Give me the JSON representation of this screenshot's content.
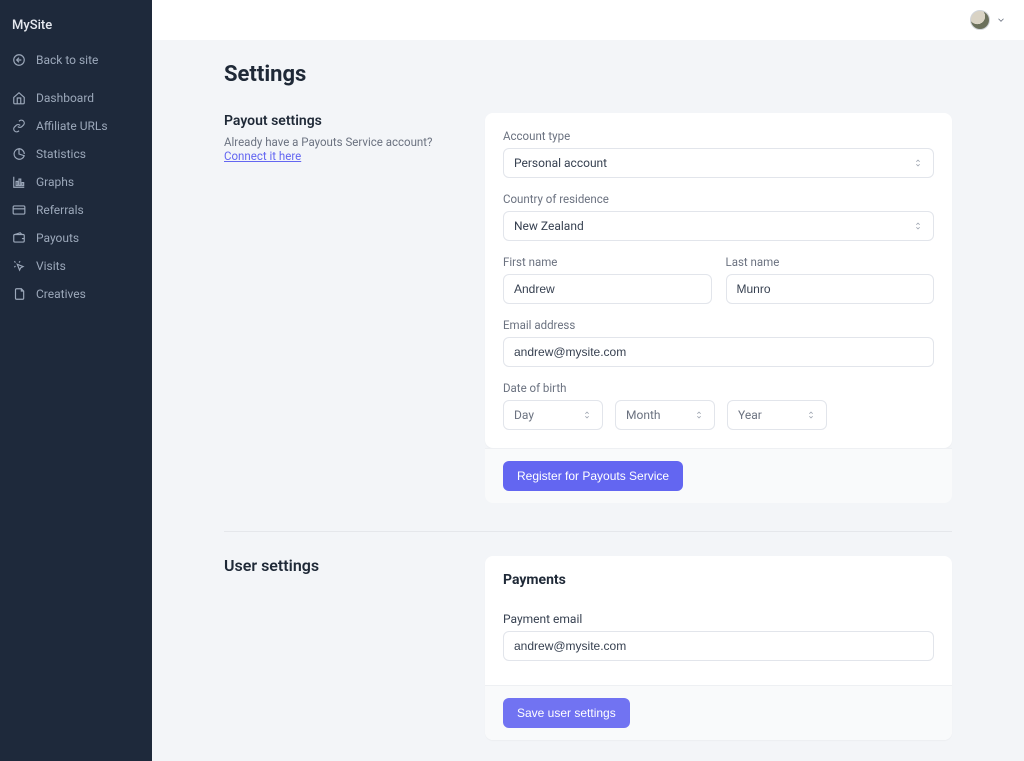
{
  "site_name": "MySite",
  "back_to_site": "Back to site",
  "nav": {
    "dashboard": "Dashboard",
    "affiliate_urls": "Affiliate URLs",
    "statistics": "Statistics",
    "graphs": "Graphs",
    "referrals": "Referrals",
    "payouts": "Payouts",
    "visits": "Visits",
    "creatives": "Creatives"
  },
  "page_title": "Settings",
  "payout": {
    "heading": "Payout settings",
    "already_text": "Already have a Payouts Service account? ",
    "connect_link": "Connect it here",
    "account_type_label": "Account type",
    "account_type_value": "Personal account",
    "country_label": "Country of residence",
    "country_value": "New Zealand",
    "first_name_label": "First name",
    "first_name_value": "Andrew",
    "last_name_label": "Last name",
    "last_name_value": "Munro",
    "email_label": "Email address",
    "email_value": "andrew@mysite.com",
    "dob_label": "Date of birth",
    "dob_day": "Day",
    "dob_month": "Month",
    "dob_year": "Year",
    "register_button": "Register for Payouts Service"
  },
  "user": {
    "heading": "User settings",
    "payments_title": "Payments",
    "payment_email_label": "Payment email",
    "payment_email_value": "andrew@mysite.com",
    "save_button": "Save user settings"
  }
}
